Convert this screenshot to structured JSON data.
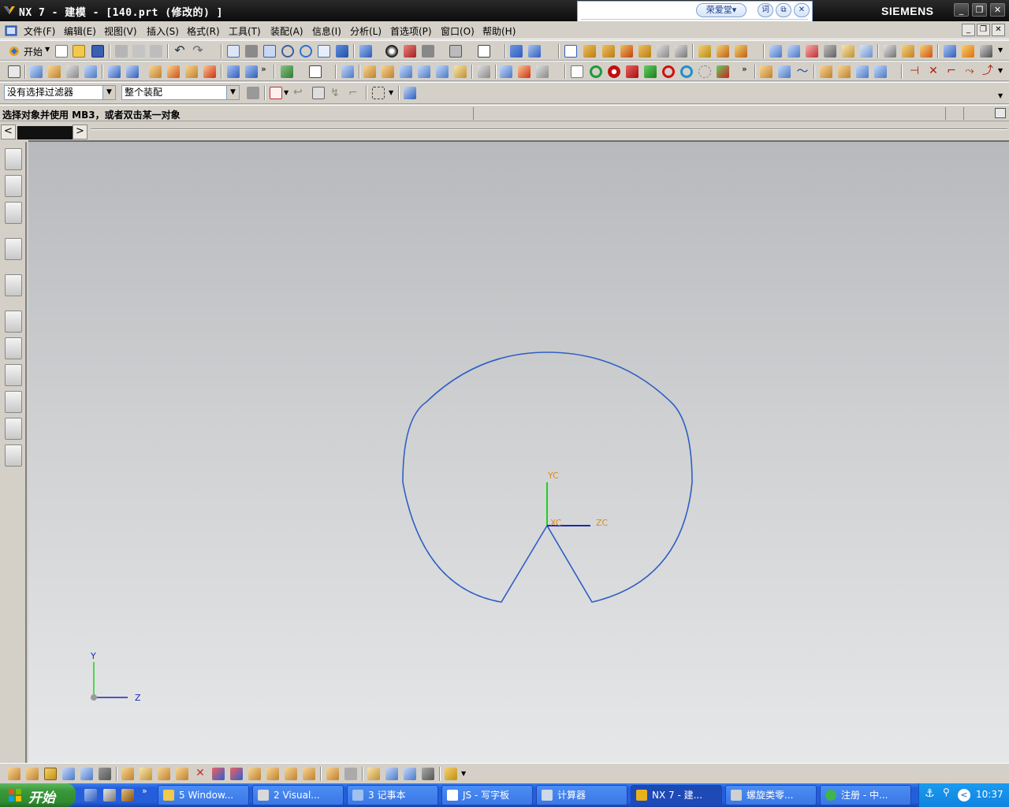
{
  "window": {
    "title": "NX 7 - 建模 - [140.prt (修改的) ]",
    "brand": "SIEMENS"
  },
  "ime": {
    "label": "荣爱堂▾",
    "btn_word": "词"
  },
  "menubar": {
    "items": [
      {
        "label": "文件(F)"
      },
      {
        "label": "编辑(E)"
      },
      {
        "label": "视图(V)"
      },
      {
        "label": "插入(S)"
      },
      {
        "label": "格式(R)"
      },
      {
        "label": "工具(T)"
      },
      {
        "label": "装配(A)"
      },
      {
        "label": "信息(I)"
      },
      {
        "label": "分析(L)"
      },
      {
        "label": "首选项(P)"
      },
      {
        "label": "窗口(O)"
      },
      {
        "label": "帮助(H)"
      }
    ]
  },
  "toolbar": {
    "start_label": "开始"
  },
  "selection": {
    "filter_value": "没有选择过滤器",
    "scope_value": "整个装配"
  },
  "cue_line": "选择对象并使用 MB3，或者双击某一对象",
  "viewport": {
    "wcs_labels": {
      "yc": "YC",
      "xc": "XC",
      "zc": "ZC"
    },
    "triad_labels": {
      "y": "Y",
      "z": "Z"
    },
    "colors": {
      "curve": "#2f5fc4",
      "axis_y": "#1fd01f",
      "axis_z": "#1a2ab0",
      "label": "#e08a1a",
      "triad_label": "#1a2ab0"
    }
  },
  "taskbar": {
    "start_label": "开始",
    "tasks": [
      {
        "label": "5 Window..."
      },
      {
        "label": "2 Visual..."
      },
      {
        "label": "3 记事本"
      },
      {
        "label": "JS - 写字板"
      },
      {
        "label": "计算器"
      },
      {
        "label": "NX 7 - 建..."
      },
      {
        "label": "螺旋类零..."
      },
      {
        "label": "注册 - 中..."
      }
    ],
    "clock": "10:37"
  }
}
